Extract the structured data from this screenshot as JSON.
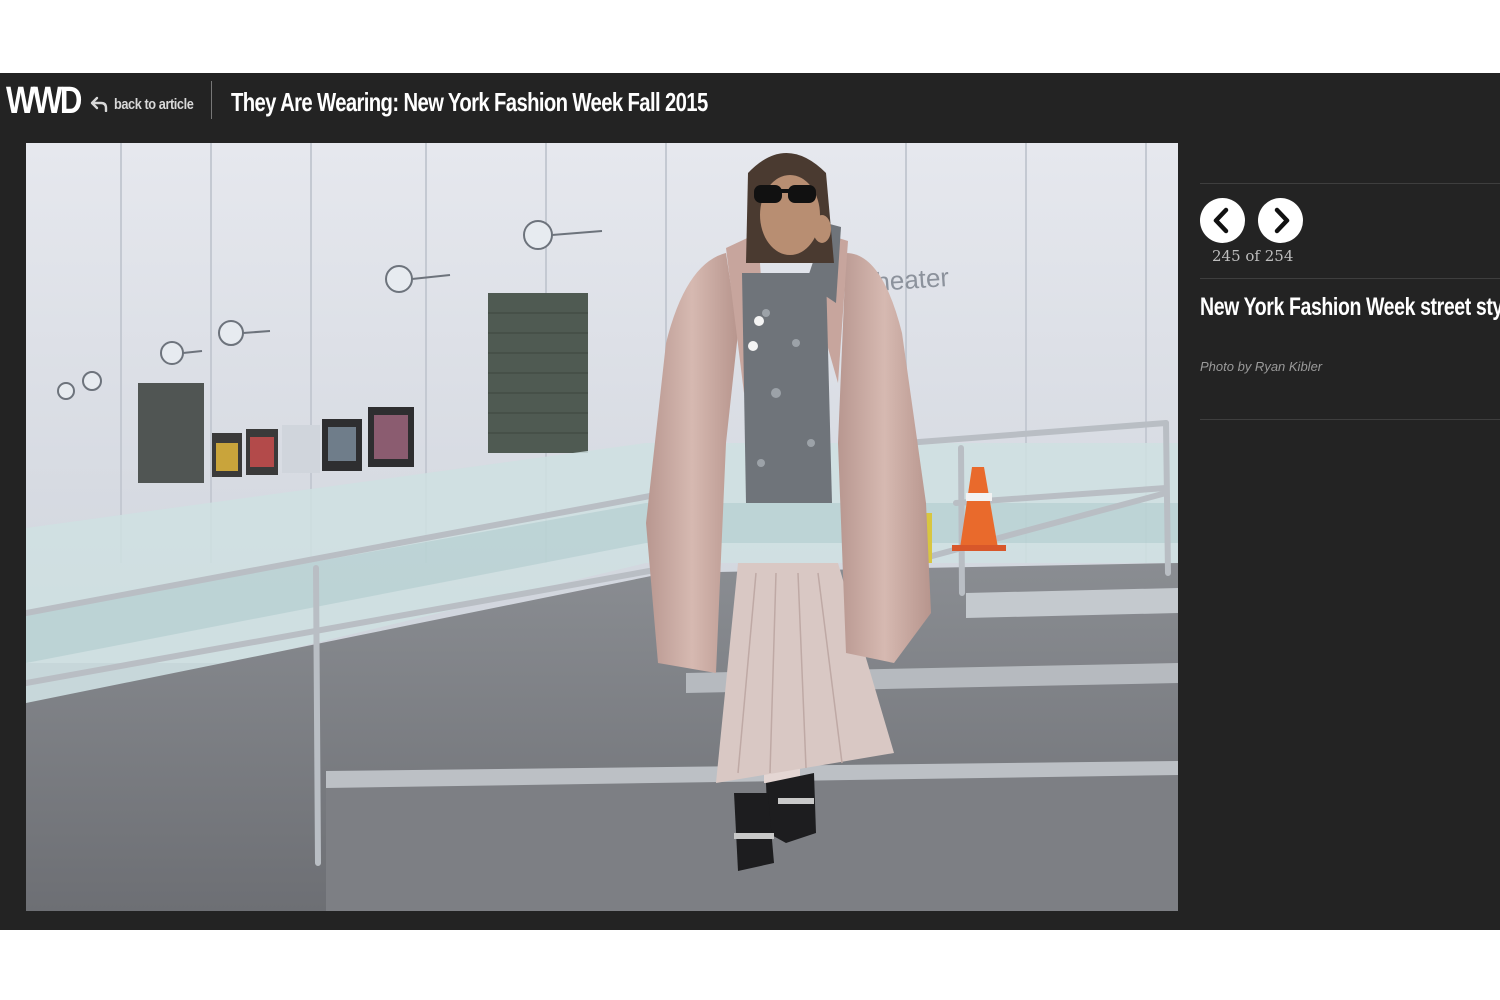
{
  "header": {
    "logo": "WWD",
    "back_label": "back to article",
    "title": "They Are Wearing: New York Fashion Week Fall 2015"
  },
  "photo": {
    "wall_sign": "heater"
  },
  "sidebar": {
    "prev_icon": "chevron-left-icon",
    "next_icon": "chevron-right-icon",
    "counter": "245 of 254",
    "caption": "New York Fashion Week street style.",
    "credit": "Photo by Ryan Kibler"
  },
  "colors": {
    "viewer_bg": "#232323",
    "page_bg": "#ffffff",
    "text_primary": "#ffffff",
    "text_muted": "#9a9a9a"
  }
}
